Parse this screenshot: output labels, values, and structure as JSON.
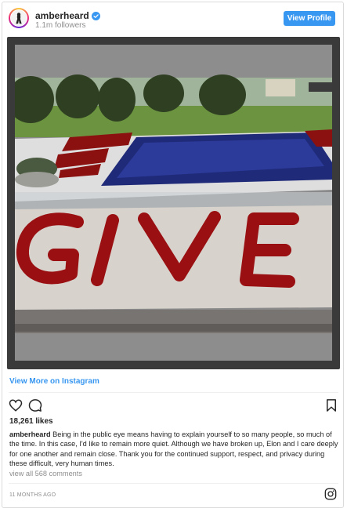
{
  "header": {
    "username": "amberheard",
    "followers": "1.1m followers",
    "view_profile_label": "View Profile",
    "verified_icon": "verified-badge-icon",
    "avatar_icon": "avatar"
  },
  "photo": {
    "word_in_roses": "GIVE"
  },
  "view_more_label": "View More on Instagram",
  "actions": {
    "like_icon": "heart-icon",
    "comment_icon": "comment-icon",
    "save_icon": "bookmark-icon"
  },
  "likes": "18,261 likes",
  "caption": {
    "user": "amberheard",
    "text": " Being in the public eye means having to explain yourself to so many people, so much of the time. In this case, I'd like to remain more quiet. Although we have broken up, Elon and I care deeply for one another and remain close. Thank you for the continued support, respect, and privacy during these difficult, very human times."
  },
  "comments_link": "view all 568 comments",
  "timestamp": "11 MONTHS AGO",
  "footer": {
    "logo_icon": "instagram-logo-icon"
  },
  "colors": {
    "accent": "#3897f0",
    "text": "#262626",
    "muted": "#8e8e8e"
  }
}
